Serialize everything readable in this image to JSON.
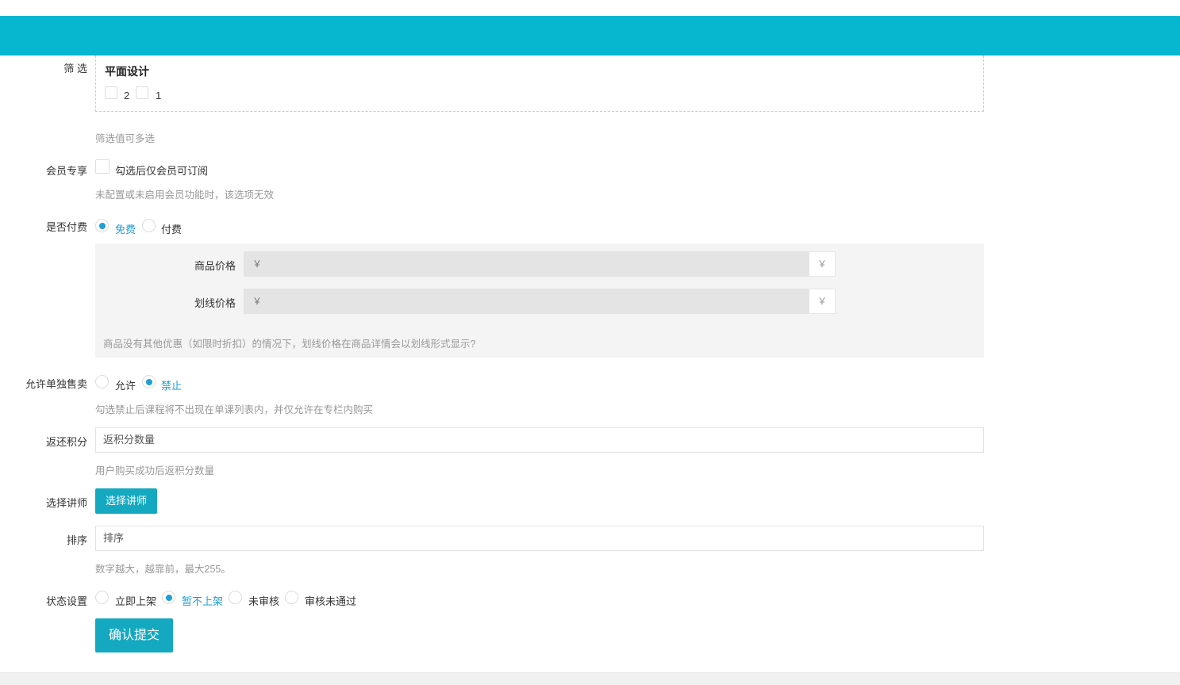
{
  "filter": {
    "label": "筛 选",
    "group_title": "平面设计",
    "options": [
      {
        "label": "2",
        "checked": false
      },
      {
        "label": "1",
        "checked": false
      }
    ],
    "hint": "筛选值可多选"
  },
  "member_only": {
    "label": "会员专享",
    "checkbox_label": "勾选后仅会员可订阅",
    "checked": false,
    "hint": "未配置或未启用会员功能时，该选项无效"
  },
  "paid": {
    "label": "是否付费",
    "options": [
      {
        "label": "免费",
        "selected": true
      },
      {
        "label": "付费",
        "selected": false
      }
    ],
    "price_label": "商品价格",
    "price_value": "￥",
    "price_suffix": "￥",
    "strike_label": "划线价格",
    "strike_value": "￥",
    "strike_suffix": "￥",
    "price_hint": "商品没有其他优惠（如限时折扣）的情况下，划线价格在商品详情会以划线形式显示?"
  },
  "sell_alone": {
    "label": "允许单独售卖",
    "options": [
      {
        "label": "允许",
        "selected": false
      },
      {
        "label": "禁止",
        "selected": true
      }
    ],
    "hint": "勾选禁止后课程将不出现在单课列表内，并仅允许在专栏内购买"
  },
  "points": {
    "label": "返还积分",
    "placeholder": "返积分数量",
    "hint": "用户购买成功后返积分数量"
  },
  "lecturer": {
    "label": "选择讲师",
    "button": "选择讲师"
  },
  "sort": {
    "label": "排序",
    "placeholder": "排序",
    "hint": "数字越大，越靠前，最大255。"
  },
  "status": {
    "label": "状态设置",
    "options": [
      {
        "label": "立即上架",
        "selected": false
      },
      {
        "label": "暂不上架",
        "selected": true
      },
      {
        "label": "未审核",
        "selected": false
      },
      {
        "label": "审核未通过",
        "selected": false
      }
    ]
  },
  "submit": "确认提交",
  "colors": {
    "accent": "#06b7cf",
    "button": "#14a9c1",
    "radio_active": "#1e9fd6"
  }
}
